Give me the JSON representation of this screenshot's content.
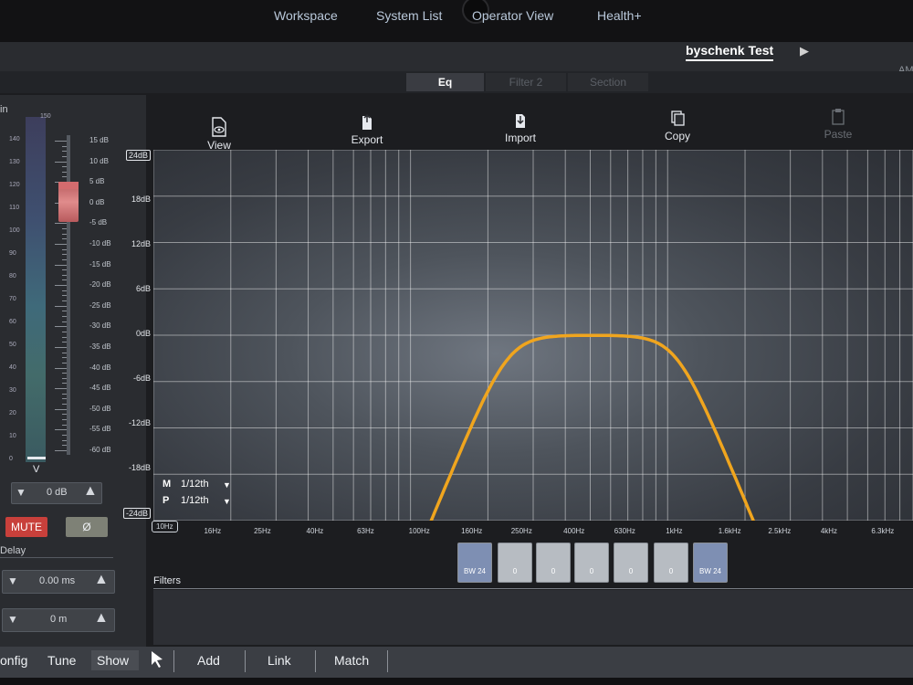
{
  "nav": {
    "items": [
      "Workspace",
      "System List",
      "Operator View",
      "Health+",
      "byschenk Test"
    ],
    "active": "byschenk Test",
    "overflow_label": "AM"
  },
  "subtabs": {
    "items": [
      "Eq",
      "Filter 2",
      "Section"
    ],
    "active": "Eq"
  },
  "toolbar": {
    "view": "View",
    "export": "Export",
    "import": "Import",
    "copy": "Copy",
    "paste": "Paste"
  },
  "left_panel": {
    "title_partial": "in",
    "meter_labels": [
      "150",
      "140",
      "130",
      "120",
      "110",
      "100",
      "90",
      "80",
      "70",
      "60",
      "50",
      "40",
      "30",
      "20",
      "10",
      "0"
    ],
    "meter_unit": "V",
    "fader_labels": [
      "15 dB",
      "10 dB",
      "5 dB",
      "0 dB",
      "-5 dB",
      "-10 dB",
      "-15 dB",
      "-20 dB",
      "-25 dB",
      "-30 dB",
      "-35 dB",
      "-40 dB",
      "-45 dB",
      "-50 dB",
      "-55 dB",
      "-60 dB"
    ],
    "gain_value": "0 dB",
    "mute_label": "MUTE",
    "phase_label": "Ø",
    "delay_title": "Delay",
    "delay_time": "0.00 ms",
    "delay_distance": "0 m"
  },
  "eq": {
    "db_axis": [
      "24dB",
      "18dB",
      "12dB",
      "6dB",
      "0dB",
      "-6dB",
      "-12dB",
      "-18dB",
      "-24dB"
    ],
    "freq_axis": [
      "10Hz",
      "16Hz",
      "25Hz",
      "40Hz",
      "63Hz",
      "100Hz",
      "160Hz",
      "250Hz",
      "400Hz",
      "630Hz",
      "1kHz",
      "1.6kHz",
      "2.5kHz",
      "4kHz",
      "6.3kHz"
    ],
    "m_label": "M",
    "m_value": "1/12th",
    "p_label": "P",
    "p_value": "1/12th",
    "curve_color": "#f0a51e",
    "filter_buttons": [
      {
        "label": "BW 24",
        "kind": "highpass"
      },
      {
        "label": "0",
        "kind": "peq"
      },
      {
        "label": "0",
        "kind": "peq"
      },
      {
        "label": "0",
        "kind": "peq"
      },
      {
        "label": "0",
        "kind": "peq"
      },
      {
        "label": "0",
        "kind": "peq"
      },
      {
        "label": "BW 24",
        "kind": "lowpass"
      }
    ],
    "filters_title": "Filters"
  },
  "bottom_tabs": [
    "onfig",
    "Tune",
    "Show",
    "Add",
    "Link",
    "Match"
  ],
  "colors": {
    "accent_red": "#c8403b",
    "curve": "#f0a51e",
    "bw_button": "#7e8fb3"
  }
}
